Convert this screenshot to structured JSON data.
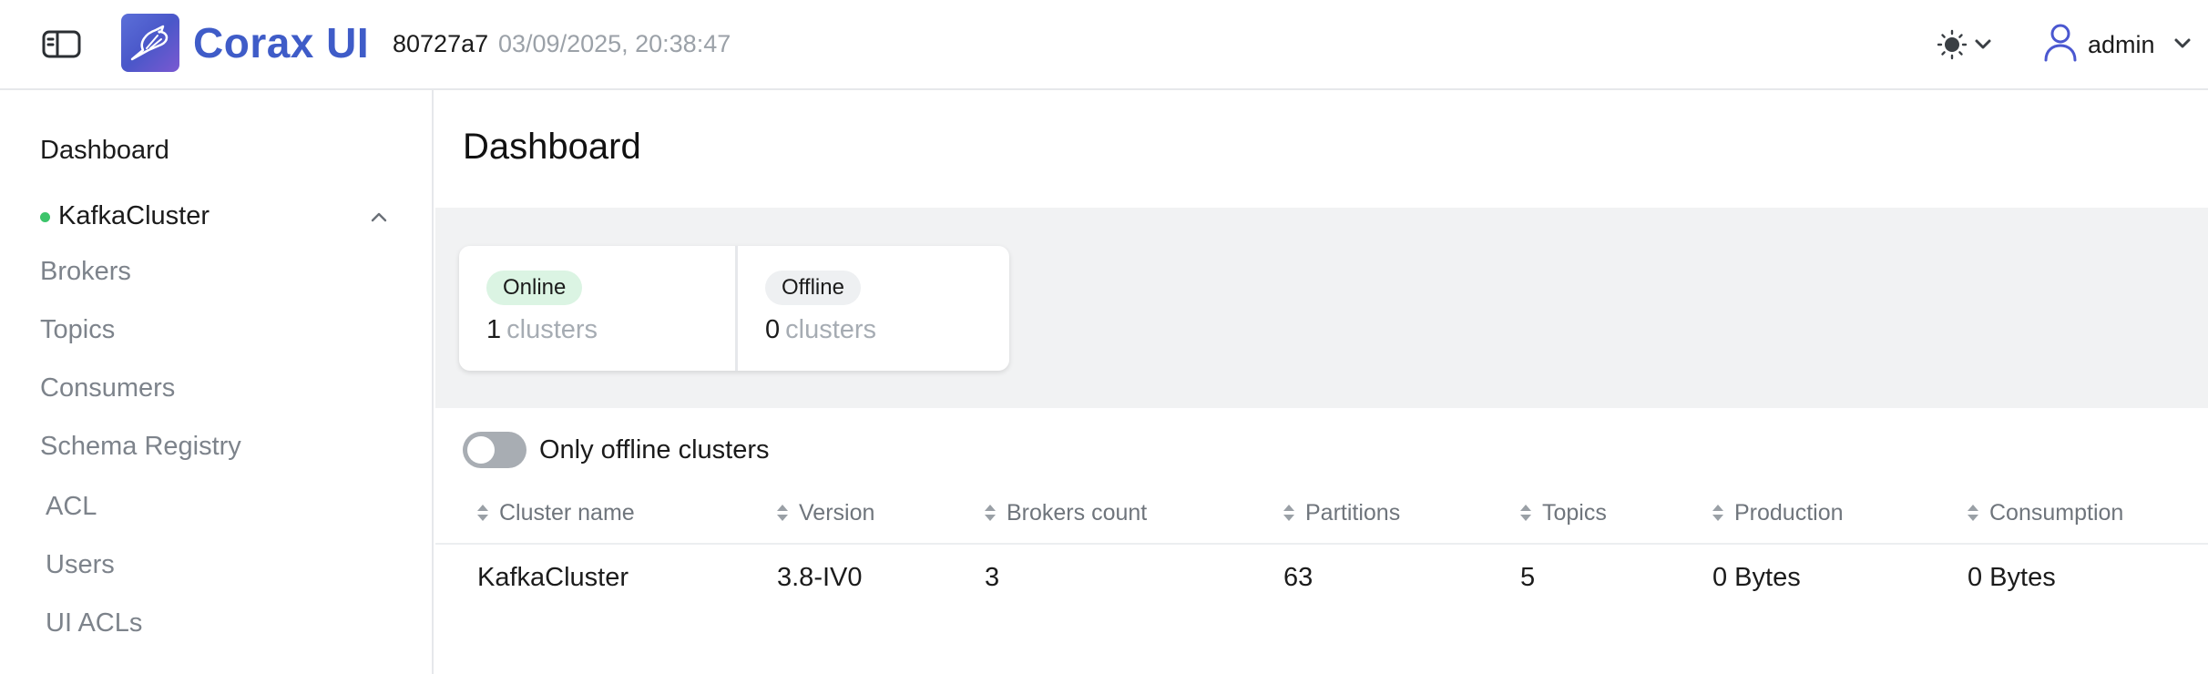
{
  "header": {
    "brand": "Corax UI",
    "version_hash": "80727a7",
    "version_date": "03/09/2025, 20:38:47",
    "user": "admin",
    "brand_color": "#3f5cc8"
  },
  "sidebar": {
    "dashboard": "Dashboard",
    "cluster": {
      "name": "KafkaCluster",
      "status_color": "#3cc46a"
    },
    "cluster_items": [
      "Brokers",
      "Topics",
      "Consumers",
      "Schema Registry"
    ],
    "admin_items": [
      "ACL",
      "Users",
      "UI ACLs"
    ]
  },
  "main": {
    "title": "Dashboard",
    "stats": {
      "online_label": "Online",
      "online_count": "1",
      "offline_label": "Offline",
      "offline_count": "0",
      "unit": "clusters"
    },
    "toggle_label": "Only offline clusters",
    "table": {
      "columns": [
        "Cluster name",
        "Version",
        "Brokers count",
        "Partitions",
        "Topics",
        "Production",
        "Consumption"
      ],
      "rows": [
        [
          "KafkaCluster",
          "3.8-IV0",
          "3",
          "63",
          "5",
          "0 Bytes",
          "0 Bytes"
        ]
      ]
    }
  }
}
